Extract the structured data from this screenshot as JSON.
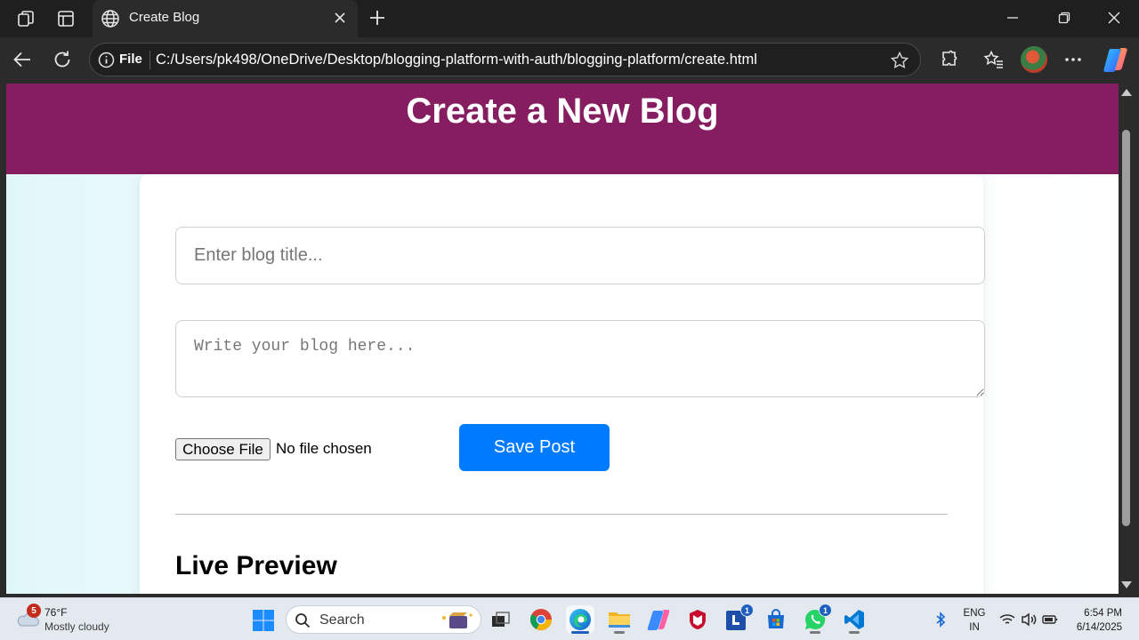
{
  "browser": {
    "tab": {
      "title": "Create Blog",
      "icon": "globe-icon"
    },
    "address": {
      "scheme_label": "File",
      "url": "C:/Users/pk498/OneDrive/Desktop/blogging-platform-with-auth/blogging-platform/create.html"
    },
    "icons": [
      "workspaces-icon",
      "tab-actions-icon",
      "new-tab-icon",
      "minimize-icon",
      "maximize-icon",
      "close-window-icon",
      "back-icon",
      "refresh-icon",
      "info-icon",
      "favorite-star-icon",
      "extensions-icon",
      "favorites-icon",
      "profile-avatar",
      "more-icon",
      "copilot-icon"
    ]
  },
  "page": {
    "header_title": "Create a New Blog",
    "form": {
      "title_placeholder": "Enter blog title...",
      "content_placeholder": "Write your blog here...",
      "file_button_label": "Choose File",
      "file_status": "No file chosen",
      "save_label": "Save Post"
    },
    "preview_heading": "Live Preview",
    "colors": {
      "header_bg": "#861d61",
      "save_button": "#007bff",
      "page_bg_left": "#e0f7fa"
    }
  },
  "taskbar": {
    "weather": {
      "badge": "5",
      "temp": "76°F",
      "desc": "Mostly cloudy"
    },
    "search_label": "Search",
    "apps": [
      {
        "name": "task-view",
        "badge": ""
      },
      {
        "name": "chrome",
        "badge": ""
      },
      {
        "name": "edge",
        "badge": "",
        "active": true
      },
      {
        "name": "file-explorer",
        "badge": ""
      },
      {
        "name": "copilot",
        "badge": ""
      },
      {
        "name": "mcafee",
        "badge": ""
      },
      {
        "name": "lens",
        "badge": "1"
      },
      {
        "name": "microsoft-store",
        "badge": ""
      },
      {
        "name": "whatsapp",
        "badge": "1"
      },
      {
        "name": "vscode",
        "badge": ""
      }
    ],
    "lang": {
      "line1": "ENG",
      "line2": "IN"
    },
    "clock": {
      "time": "6:54 PM",
      "date": "6/14/2025"
    }
  }
}
